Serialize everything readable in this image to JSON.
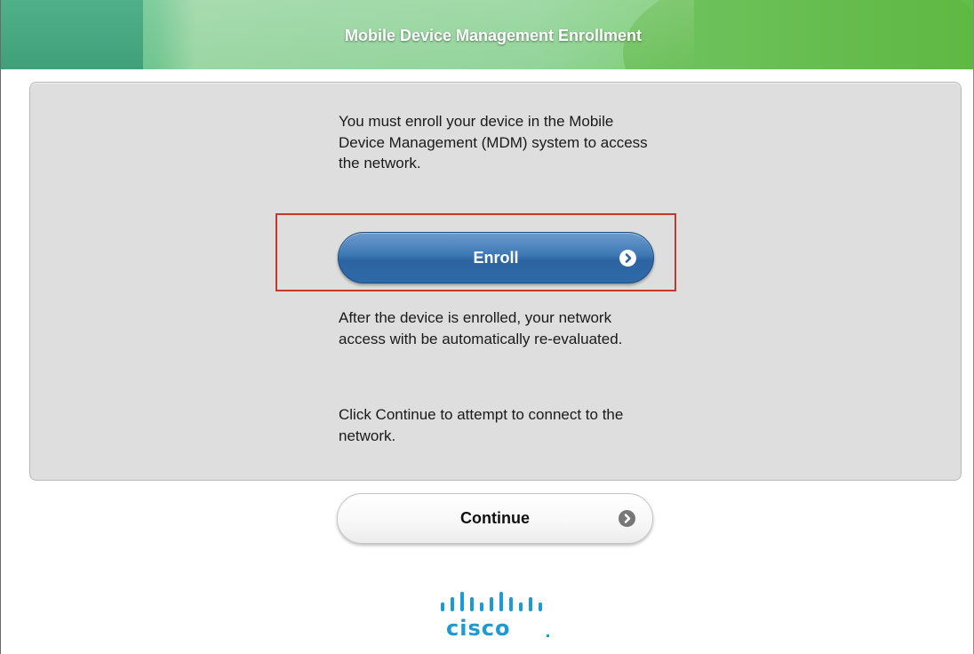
{
  "header": {
    "title": "Mobile Device Management Enrollment"
  },
  "panel": {
    "intro_text": "You must enroll your device in the Mobile Device Management (MDM) system to access the network.",
    "after_text": "After the device is enrolled, your network access with be automatically re-evaluated.",
    "continue_hint": "Click Continue to attempt to connect to the network."
  },
  "buttons": {
    "enroll_label": "Enroll",
    "continue_label": "Continue"
  },
  "logo": {
    "text": "cisco"
  },
  "icons": {
    "enroll_chevron": "chevron-right-circle-icon",
    "continue_chevron": "chevron-right-circle-icon",
    "logo_bars": "cisco-bridge-bars-icon"
  },
  "colors": {
    "header_green": "#7ccc73",
    "enroll_blue": "#3d78b4",
    "highlight_red": "#c0392b",
    "cisco_blue": "#1b9ad6",
    "panel_gray": "#dedede"
  }
}
